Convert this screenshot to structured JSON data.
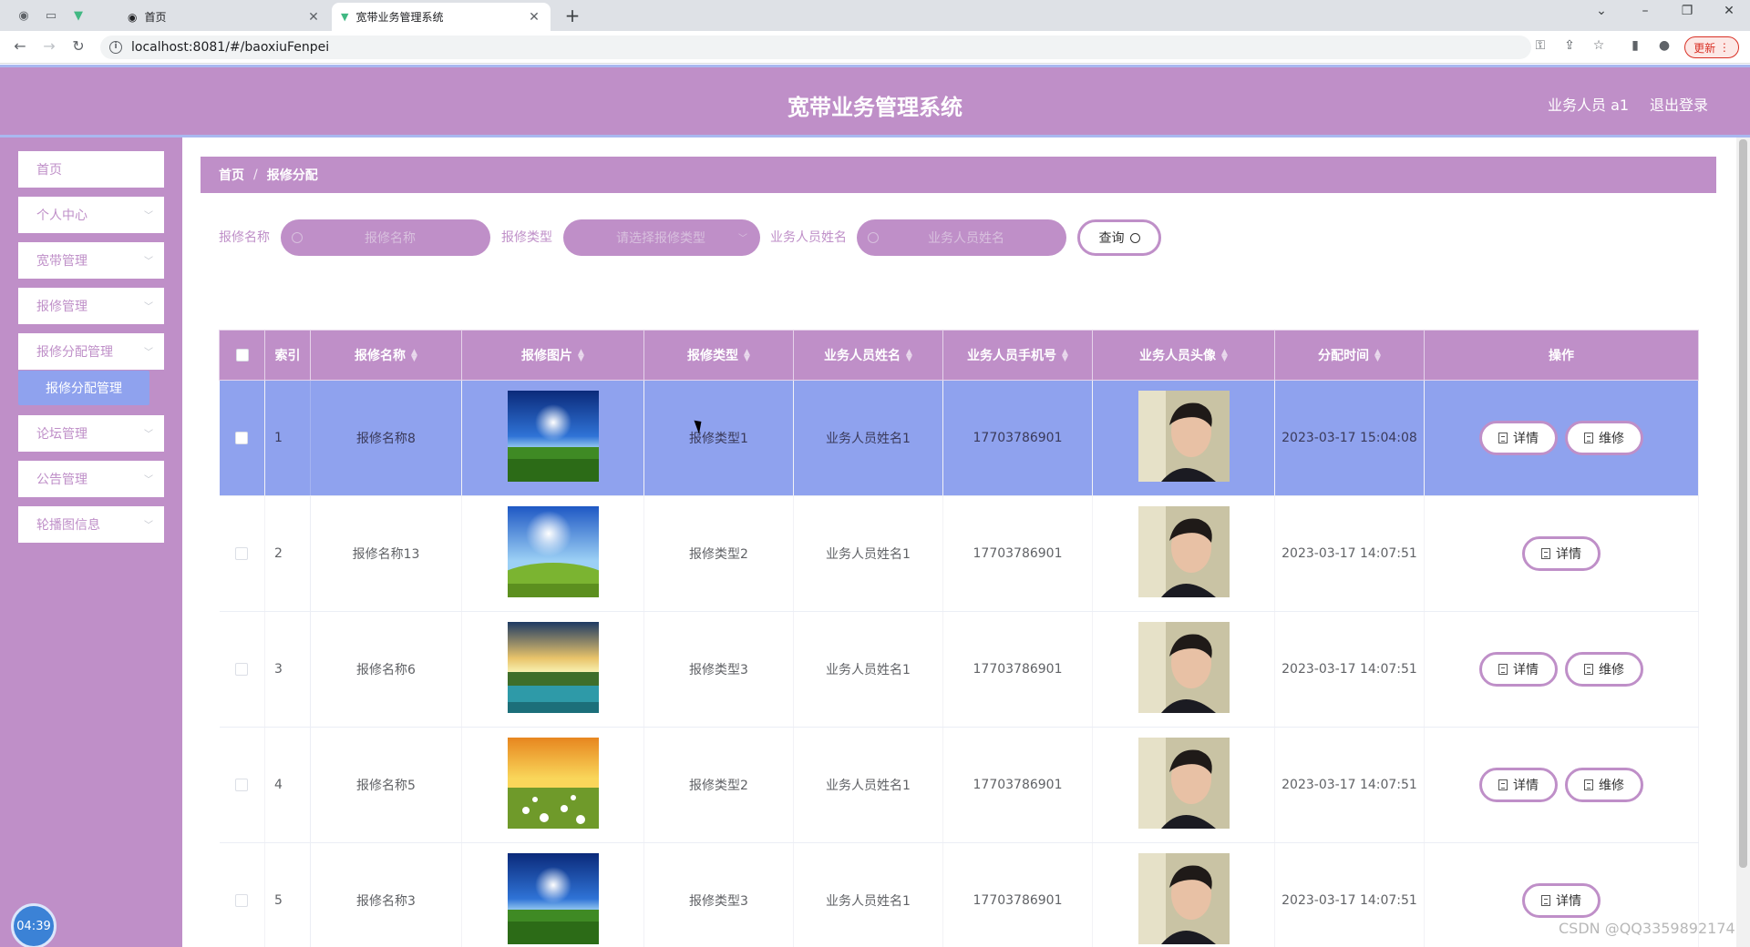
{
  "browser": {
    "tabs": [
      {
        "title": "首页"
      },
      {
        "title": "宽带业务管理系统"
      }
    ],
    "new_tab": "+",
    "url": "localhost:8081/#/baoxiuFenpei",
    "update_label": "更新"
  },
  "header": {
    "title": "宽带业务管理系统",
    "user": "业务人员 a1",
    "logout": "退出登录"
  },
  "sidebar": {
    "items": [
      {
        "label": "首页"
      },
      {
        "label": "个人中心"
      },
      {
        "label": "宽带管理"
      },
      {
        "label": "报修管理"
      },
      {
        "label": "报修分配管理"
      },
      {
        "label": "论坛管理"
      },
      {
        "label": "公告管理"
      },
      {
        "label": "轮播图信息"
      }
    ],
    "submenu_active": "报修分配管理",
    "clock": "04:39"
  },
  "breadcrumb": {
    "home": "首页",
    "sep": "/",
    "current": "报修分配"
  },
  "search": {
    "name_label": "报修名称",
    "name_placeholder": "报修名称",
    "type_label": "报修类型",
    "type_placeholder": "请选择报修类型",
    "staff_label": "业务人员姓名",
    "staff_placeholder": "业务人员姓名",
    "query_label": "查询"
  },
  "table": {
    "headers": [
      "索引",
      "报修名称",
      "报修图片",
      "报修类型",
      "业务人员姓名",
      "业务人员手机号",
      "业务人员头像",
      "分配时间",
      "操作"
    ],
    "rows": [
      {
        "index": "1",
        "name": "报修名称8",
        "type": "报修类型1",
        "staff": "业务人员姓名1",
        "phone": "17703786901",
        "time": "2023-03-17 15:04:08",
        "image": "blue-sky-sun-grass",
        "actions": [
          "详情",
          "维修"
        ]
      },
      {
        "index": "2",
        "name": "报修名称13",
        "type": "报修类型2",
        "staff": "业务人员姓名1",
        "phone": "17703786901",
        "time": "2023-03-17 14:07:51",
        "image": "blue-sky-green-hill",
        "actions": [
          "详情"
        ]
      },
      {
        "index": "3",
        "name": "报修名称6",
        "type": "报修类型3",
        "staff": "业务人员姓名1",
        "phone": "17703786901",
        "time": "2023-03-17 14:07:51",
        "image": "sunset-lake",
        "actions": [
          "详情",
          "维修"
        ]
      },
      {
        "index": "4",
        "name": "报修名称5",
        "type": "报修类型2",
        "staff": "业务人员姓名1",
        "phone": "17703786901",
        "time": "2023-03-17 14:07:51",
        "image": "orange-sky-daisies",
        "actions": [
          "详情",
          "维修"
        ]
      },
      {
        "index": "5",
        "name": "报修名称3",
        "type": "报修类型3",
        "staff": "业务人员姓名1",
        "phone": "17703786901",
        "time": "2023-03-17 14:07:51",
        "image": "blue-sky-sun-grass",
        "actions": [
          "详情"
        ]
      }
    ]
  },
  "watermark": "CSDN @QQ3359892174",
  "colors": {
    "primary": "#bf8fc8",
    "selected_row": "#8fa2ee",
    "header_border": "#a9b8f0"
  }
}
